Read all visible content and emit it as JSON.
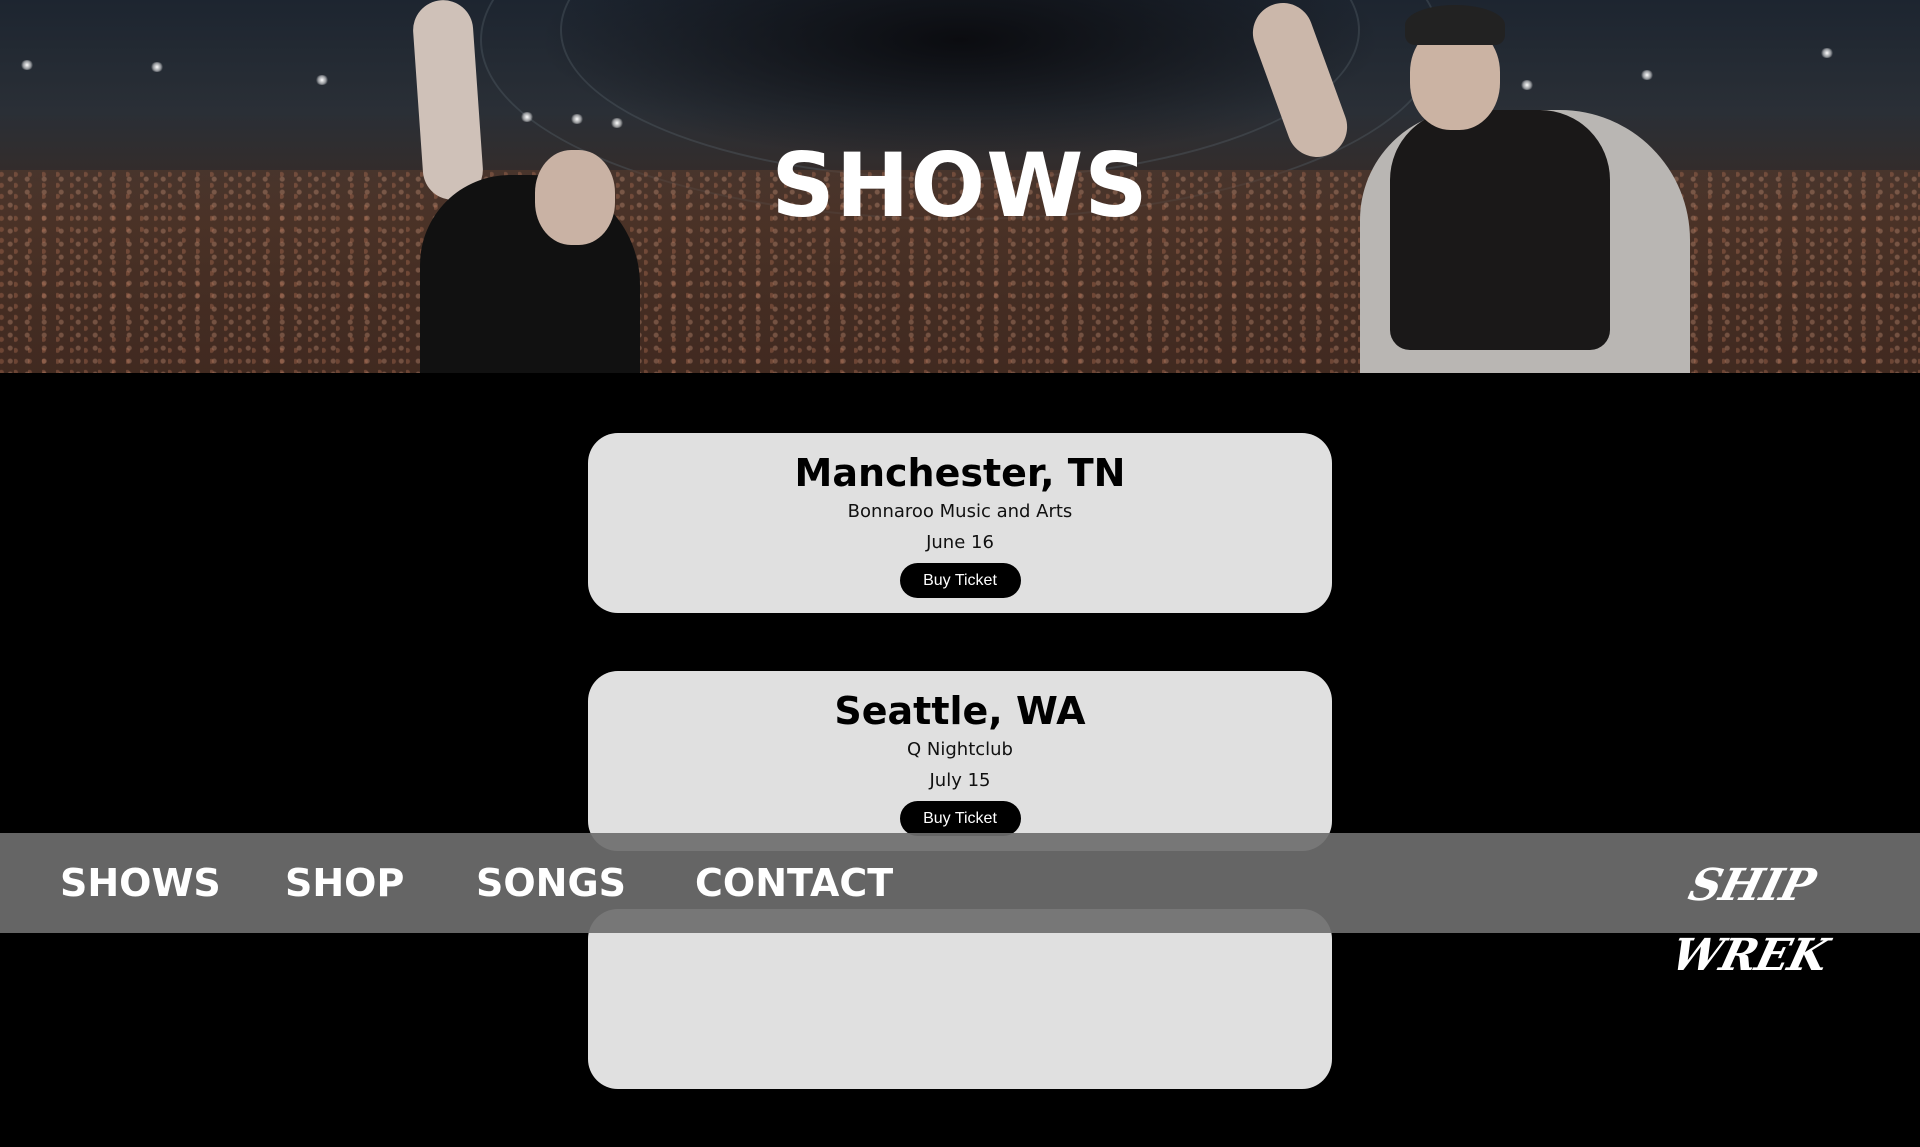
{
  "hero": {
    "title": "SHOWS"
  },
  "shows": [
    {
      "city": "Manchester, TN",
      "venue": "Bonnaroo Music and Arts",
      "date": "June 16",
      "button_label": "Buy Ticket"
    },
    {
      "city": "Seattle, WA",
      "venue": "Q Nightclub",
      "date": "July 15",
      "button_label": "Buy Ticket"
    },
    {
      "city": "",
      "venue": "",
      "date": "",
      "button_label": ""
    }
  ],
  "nav": {
    "items": [
      "SHOWS",
      "SHOP",
      "SONGS",
      "CONTACT"
    ],
    "logo_text": "SHIP WREK"
  },
  "colors": {
    "page_background": "#000000",
    "card_background": "#e0e0e0",
    "button_background": "#000000",
    "nav_background": "#6e6e6e"
  }
}
